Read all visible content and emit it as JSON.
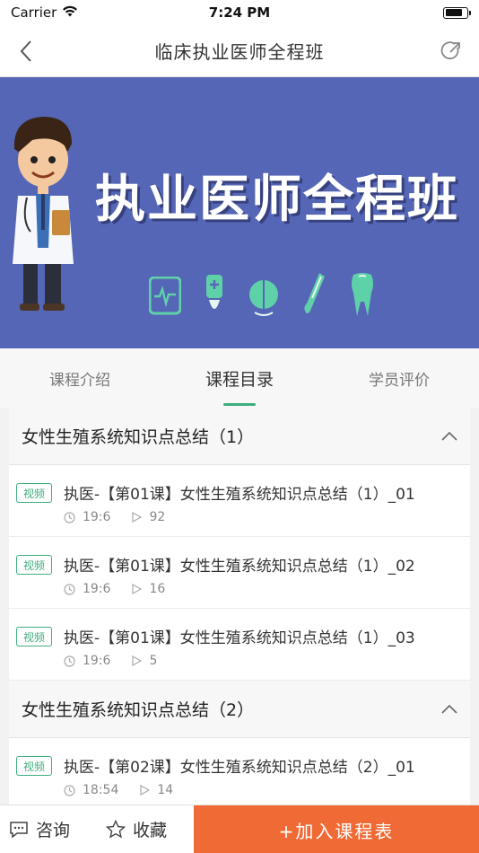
{
  "status_bar": {
    "carrier": "Carrier",
    "time": "7:24 PM"
  },
  "nav": {
    "title": "临床执业医师全程班"
  },
  "banner": {
    "title": "执业医师全程班"
  },
  "tabs": [
    {
      "label": "课程介绍",
      "active": false
    },
    {
      "label": "课程目录",
      "active": true
    },
    {
      "label": "学员评价",
      "active": false
    }
  ],
  "sections": [
    {
      "title": "女性生殖系统知识点总结（1）",
      "lessons": [
        {
          "badge": "视频",
          "title": "执医-【第01课】女性生殖系统知识点总结（1）_01",
          "duration": "19:6",
          "plays": "92"
        },
        {
          "badge": "视频",
          "title": "执医-【第01课】女性生殖系统知识点总结（1）_02",
          "duration": "19:6",
          "plays": "16"
        },
        {
          "badge": "视频",
          "title": "执医-【第01课】女性生殖系统知识点总结（1）_03",
          "duration": "19:6",
          "plays": "5"
        }
      ]
    },
    {
      "title": "女性生殖系统知识点总结（2）",
      "lessons": [
        {
          "badge": "视频",
          "title": "执医-【第02课】女性生殖系统知识点总结（2）_01",
          "duration": "18:54",
          "plays": "14"
        }
      ]
    }
  ],
  "bottom_bar": {
    "consult": "咨询",
    "favorite": "收藏",
    "join": "+加入课程表"
  },
  "colors": {
    "accent": "#3eae7c",
    "banner": "#5566b6",
    "cta": "#f06a35"
  }
}
